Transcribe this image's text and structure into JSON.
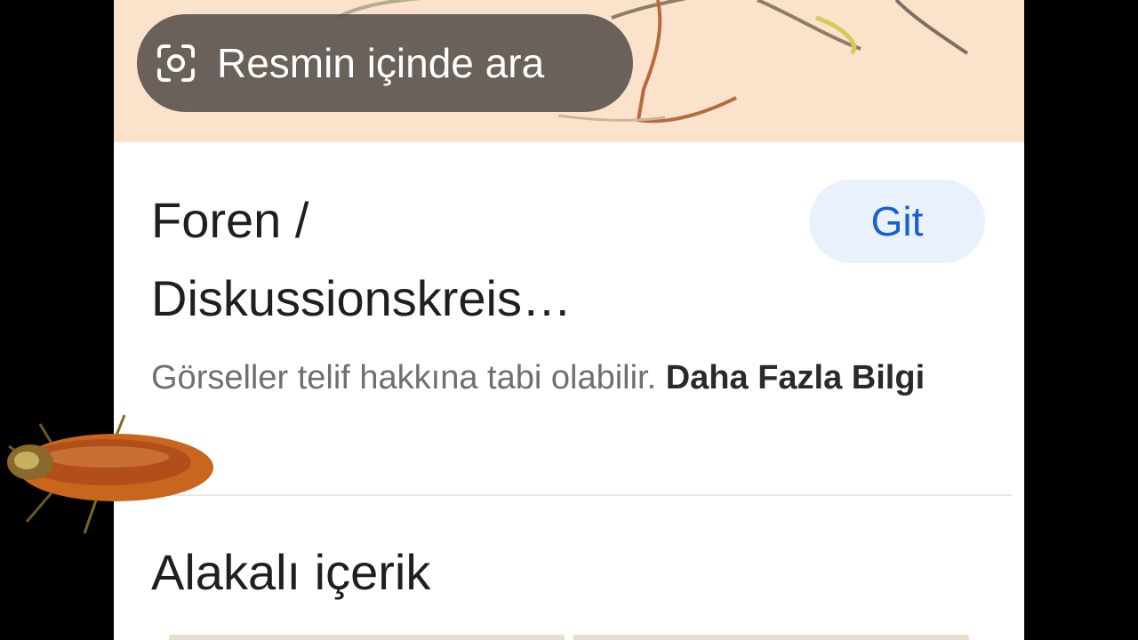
{
  "image_search": {
    "lens_button_label": "Resmin içinde ara",
    "lens_icon": "lens-scan-icon"
  },
  "result": {
    "title_line1": "Foren /",
    "title_line2": "Diskussionskreis…",
    "go_button_label": "Git",
    "copyright_text": "Görseller telif hakkına tabi olabilir.",
    "learn_more_link": "Daha Fazla Bilgi"
  },
  "related": {
    "heading": "Alakalı içerik"
  },
  "colors": {
    "preview_background": "#fbe3cb",
    "go_button_background": "#e9f1fd",
    "go_button_text": "#1a5fd0",
    "page_background": "#000000"
  }
}
